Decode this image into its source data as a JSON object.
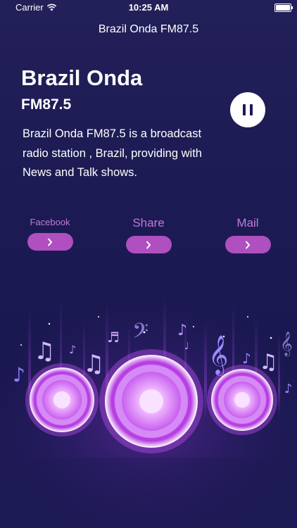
{
  "status_bar": {
    "carrier": "Carrier",
    "time": "10:25 AM"
  },
  "nav": {
    "title": "Brazil Onda FM87.5"
  },
  "station": {
    "name": "Brazil Onda",
    "frequency": "FM87.5",
    "description": "Brazil Onda FM87.5 is a broadcast radio station , Brazil, providing  with News and Talk shows."
  },
  "social": {
    "facebook_label": "Facebook",
    "share_label": "Share",
    "mail_label": "Mail"
  },
  "colors": {
    "accent": "#b04fc0",
    "label": "#c07ad8",
    "background": "#1c1a52"
  },
  "icons": [
    "wifi-icon",
    "battery-icon",
    "pause-icon",
    "chevron-right-icon",
    "music-note-icon",
    "treble-clef-icon",
    "bass-clef-icon"
  ]
}
